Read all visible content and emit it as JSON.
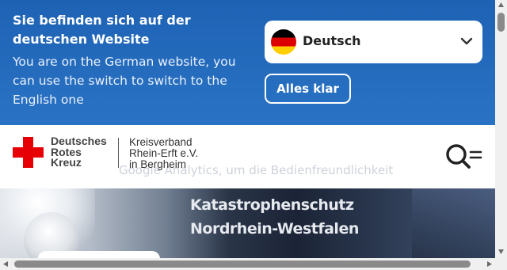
{
  "language_banner": {
    "title": "Sie befinden sich auf der deutschen Website",
    "text": "You are on the German website, you can use the switch to switch to the English one",
    "language_select": {
      "selected": "Deutsch",
      "flag_icon": "german-flag-icon"
    },
    "confirm_button": "Alles klar",
    "background_color": "#1e62b4"
  },
  "header": {
    "logo_icon": "red-cross-icon",
    "org_name": [
      "Deutsches",
      "Rotes",
      "Kreuz"
    ],
    "sub_org": [
      "Kreisverband",
      "Rhein-Erft e.V.",
      "in Bergheim"
    ],
    "search_menu_icon": "search-menu-icon",
    "background_text": "Google Analytics, um die Bedienfreundlichkeit"
  },
  "hero": {
    "vehicle_text": [
      "Katastrophenschutz",
      "Nordrhein-Westfalen"
    ]
  },
  "colors": {
    "brand_red": "#e60005",
    "banner_blue": "#1e62b4"
  }
}
